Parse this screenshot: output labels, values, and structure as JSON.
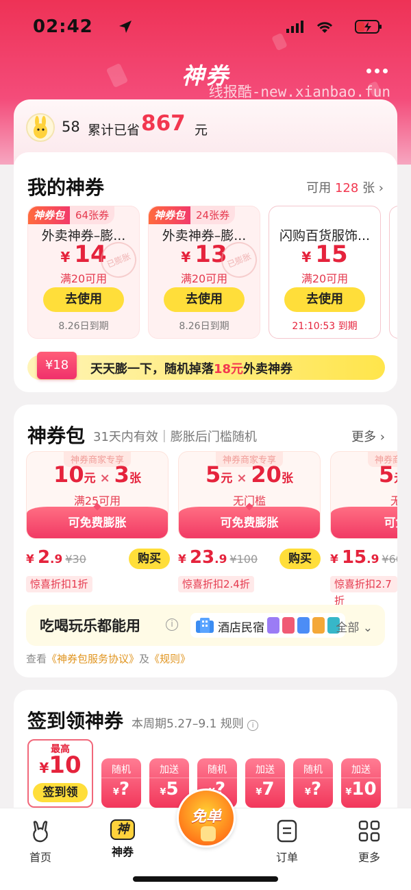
{
  "status": {
    "time": "02:42"
  },
  "header": {
    "title": "神券",
    "watermark": "线报酷-new.xianbao.fun"
  },
  "savings": {
    "level": "58",
    "label": "累计已省",
    "amount": "867",
    "unit": "元"
  },
  "my_coupons": {
    "title": "我的神券",
    "available_prefix": "可用",
    "available_count": "128",
    "available_suffix": "张",
    "coupons": [
      {
        "tag": "神券包",
        "tag_count": "64张券",
        "name": "外卖神券–膨...",
        "currency": "¥",
        "value": "14",
        "condition": "满20可用",
        "action": "去使用",
        "expiry": "8.26日到期",
        "stamp": "已膨胀"
      },
      {
        "tag": "神券包",
        "tag_count": "24张券",
        "name": "外卖神券–膨...",
        "currency": "¥",
        "value": "13",
        "condition": "满20可用",
        "action": "去使用",
        "expiry": "8.26日到期",
        "stamp": "已膨胀"
      },
      {
        "name": "闪购百货服饰...",
        "currency": "¥",
        "value": "15",
        "condition": "满20可用",
        "action": "去使用",
        "expiry": "21:10:53 到期"
      }
    ],
    "banner": {
      "chip": "¥18",
      "text_a": "天天膨一下，随机掉落",
      "highlight": "18元",
      "text_b": "外卖神券"
    }
  },
  "packs": {
    "title": "神券包",
    "subtitle": "31天内有效｜膨胀后门槛随机",
    "more": "更多",
    "items": [
      {
        "header": "神券商家专享",
        "amount": "10",
        "amount_unit": "元",
        "times": "×",
        "count": "3",
        "count_unit": "张",
        "threshold": "满25可用",
        "footer": "可免费膨胀",
        "currency": "¥",
        "price_int": "2",
        "price_dec": ".9",
        "old_price": "¥30",
        "buy": "购买",
        "discount": "惊喜折扣1折"
      },
      {
        "header": "神券商家专享",
        "amount": "5",
        "amount_unit": "元",
        "times": "×",
        "count": "20",
        "count_unit": "张",
        "threshold": "无门槛",
        "footer": "可免费膨胀",
        "currency": "¥",
        "price_int": "23",
        "price_dec": ".9",
        "old_price": "¥100",
        "buy": "购买",
        "discount": "惊喜折扣2.4折"
      },
      {
        "header": "神券商家专享",
        "amount": "5",
        "amount_unit": "元",
        "times": "×",
        "count": "",
        "count_unit": "",
        "threshold": "无门",
        "footer": "可免费",
        "currency": "¥",
        "price_int": "15",
        "price_dec": ".9",
        "old_price": "¥60",
        "buy": "",
        "discount": "惊喜折扣2.7折"
      }
    ],
    "usable": {
      "text": "吃喝玩乐都能用",
      "info": "i",
      "hotel": "酒店民宿",
      "all": "全部"
    },
    "agreement": {
      "prefix": "查看",
      "link1": "《神券包服务协议》",
      "mid": "及",
      "link2": "《规则》"
    }
  },
  "checkin": {
    "title": "签到领神券",
    "period": "本周期5.27–9.1",
    "rules": "规则",
    "first": {
      "top": "最高",
      "currency": "¥",
      "value": "10",
      "action": "签到领"
    },
    "days": [
      {
        "label": "随机",
        "currency": "¥",
        "value": "?"
      },
      {
        "label": "加送",
        "currency": "¥",
        "value": "5"
      },
      {
        "label": "随机",
        "currency": "¥",
        "value": "?"
      },
      {
        "label": "加送",
        "currency": "¥",
        "value": "7"
      },
      {
        "label": "随机",
        "currency": "¥",
        "value": "?"
      },
      {
        "label": "加送",
        "currency": "¥",
        "value": "10"
      }
    ]
  },
  "tabbar": {
    "home": "首页",
    "coupons": "神券",
    "coupons_icon_text": "神",
    "free": "免单",
    "orders": "订单",
    "more": "更多"
  },
  "colors": {
    "brand_red": "#f2374f",
    "accent_yellow": "#ffde3a",
    "header_pink": "#f44c7a"
  }
}
